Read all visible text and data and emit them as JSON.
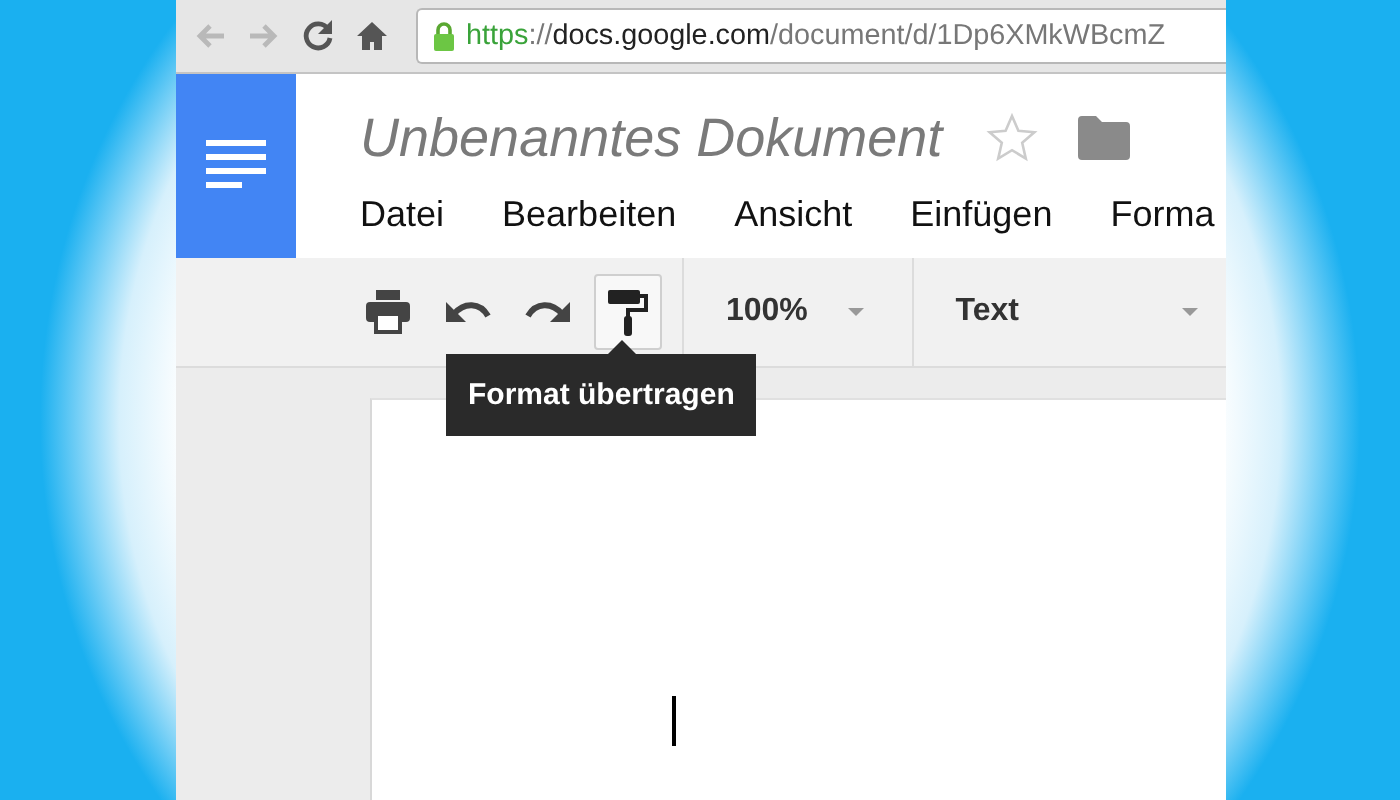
{
  "browser": {
    "nav_buttons": [
      {
        "kind": "back",
        "disabled": true
      },
      {
        "kind": "forward",
        "disabled": true
      },
      {
        "kind": "reload",
        "disabled": false
      },
      {
        "kind": "home",
        "disabled": false
      }
    ],
    "address": {
      "scheme": "https",
      "separator": "://",
      "host": "docs.google.com",
      "path": "/document/d/1Dp6XMkWBcmZ"
    }
  },
  "document": {
    "title": "Unbenanntes Dokument",
    "starred": false
  },
  "menu": [
    "Datei",
    "Bearbeiten",
    "Ansicht",
    "Einfügen",
    "Forma"
  ],
  "toolbar": {
    "buttons": [
      {
        "kind": "print",
        "selected": false
      },
      {
        "kind": "undo",
        "selected": false
      },
      {
        "kind": "redo",
        "selected": false
      },
      {
        "kind": "paint-format",
        "selected": true
      }
    ],
    "zoom": {
      "value": "100%"
    },
    "style": {
      "value": "Text"
    }
  },
  "tooltip": {
    "text": "Format übertragen"
  }
}
